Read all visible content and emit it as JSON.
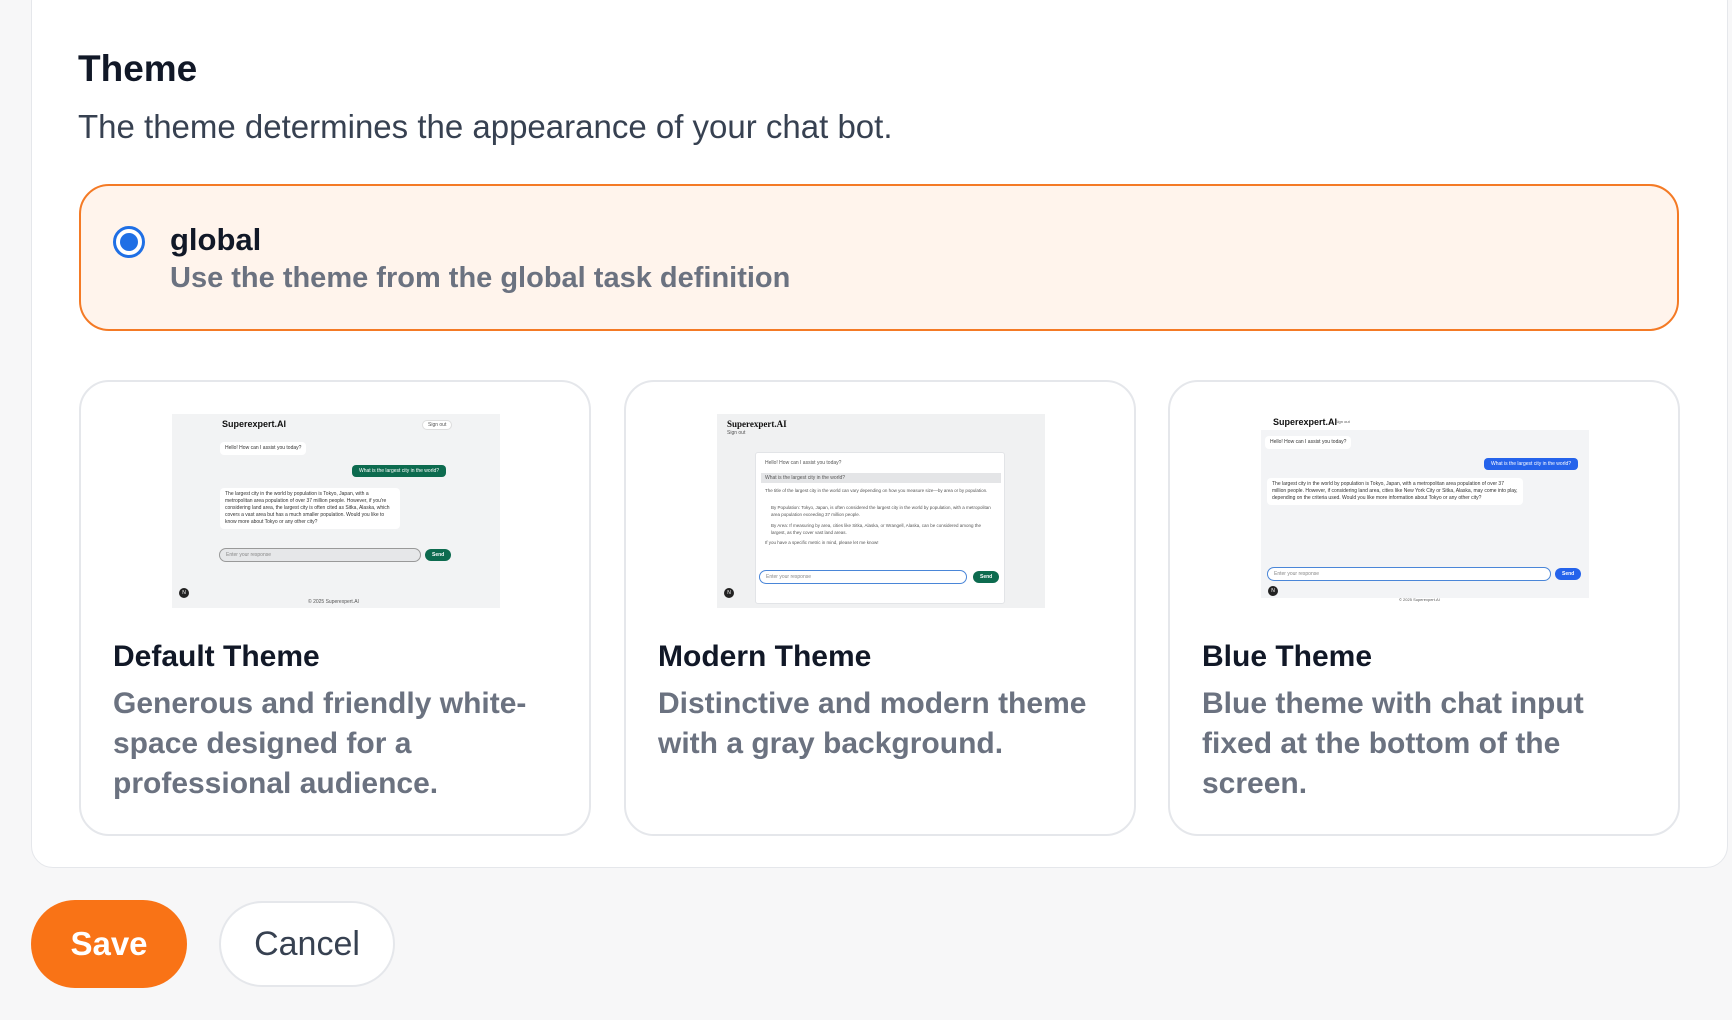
{
  "theme_section": {
    "title": "Theme",
    "description": "The theme determines the appearance of your chat bot."
  },
  "global_option": {
    "label": "global",
    "description": "Use the theme from the global task definition",
    "selected": true
  },
  "themes": [
    {
      "title": "Default Theme",
      "description": "Generous and friendly white-space designed for a professional audience.",
      "preview": {
        "brand": "Superexpert.AI",
        "sign_out": "Sign out",
        "greeting": "Hello! How can I assist you today?",
        "user_message": "What is the largest city in the world?",
        "answer": "The largest city in the world by population is Tokyo, Japan, with a metropolitan area population of over 37 million people. However, if you're considering land area, the largest city is often cited as Sitka, Alaska, which covers a vast area but has a much smaller population. Would you like to know more about Tokyo or any other city?",
        "input_placeholder": "Enter your response",
        "send": "Send",
        "footer": "© 2025 Superexpert.AI",
        "avatar": "N"
      }
    },
    {
      "title": "Modern Theme",
      "description": "Distinctive and modern theme with a gray background.",
      "preview": {
        "brand": "Superexpert.AI",
        "sign_out": "Sign out",
        "greeting": "Hello! How can I assist you today?",
        "user_message": "What is the largest city in the world?",
        "answer_intro": "The title of the largest city in the world can vary depending on how you measure size—by area or by population.",
        "answer_point_1": "By Population: Tokyo, Japan, is often considered the largest city in the world by population, with a metropolitan area population exceeding 37 million people.",
        "answer_point_2": "By Area: If measuring by area, cities like Sitka, Alaska, or Wrangell, Alaska, can be considered among the largest, as they cover vast land areas.",
        "answer_outro": "If you have a specific metric in mind, please let me know!",
        "input_placeholder": "Enter your response",
        "send": "Send",
        "avatar": "N"
      }
    },
    {
      "title": "Blue Theme",
      "description": "Blue theme with chat input fixed at the bottom of the screen.",
      "preview": {
        "brand": "Superexpert.AI",
        "sign_out": "Sign out",
        "greeting": "Hello! How can I assist you today?",
        "user_message": "What is the largest city in the world?",
        "answer": "The largest city in the world by population is Tokyo, Japan, with a metropolitan area population of over 37 million people. However, if considering land area, cities like New York City or Sitka, Alaska, may come into play, depending on the criteria used. Would you like more information about Tokyo or any other city?",
        "input_placeholder": "Enter your response",
        "send": "Send",
        "footer": "© 2025 Superexpert.AI",
        "avatar": "N"
      }
    }
  ],
  "actions": {
    "save_label": "Save",
    "cancel_label": "Cancel"
  },
  "colors": {
    "accent_orange": "#f97316",
    "selected_border": "#f47a25",
    "selected_bg": "#fff4ec",
    "radio_blue": "#1f6fe5",
    "default_theme_green": "#0d6b4f",
    "blue_theme_blue": "#2563eb"
  }
}
